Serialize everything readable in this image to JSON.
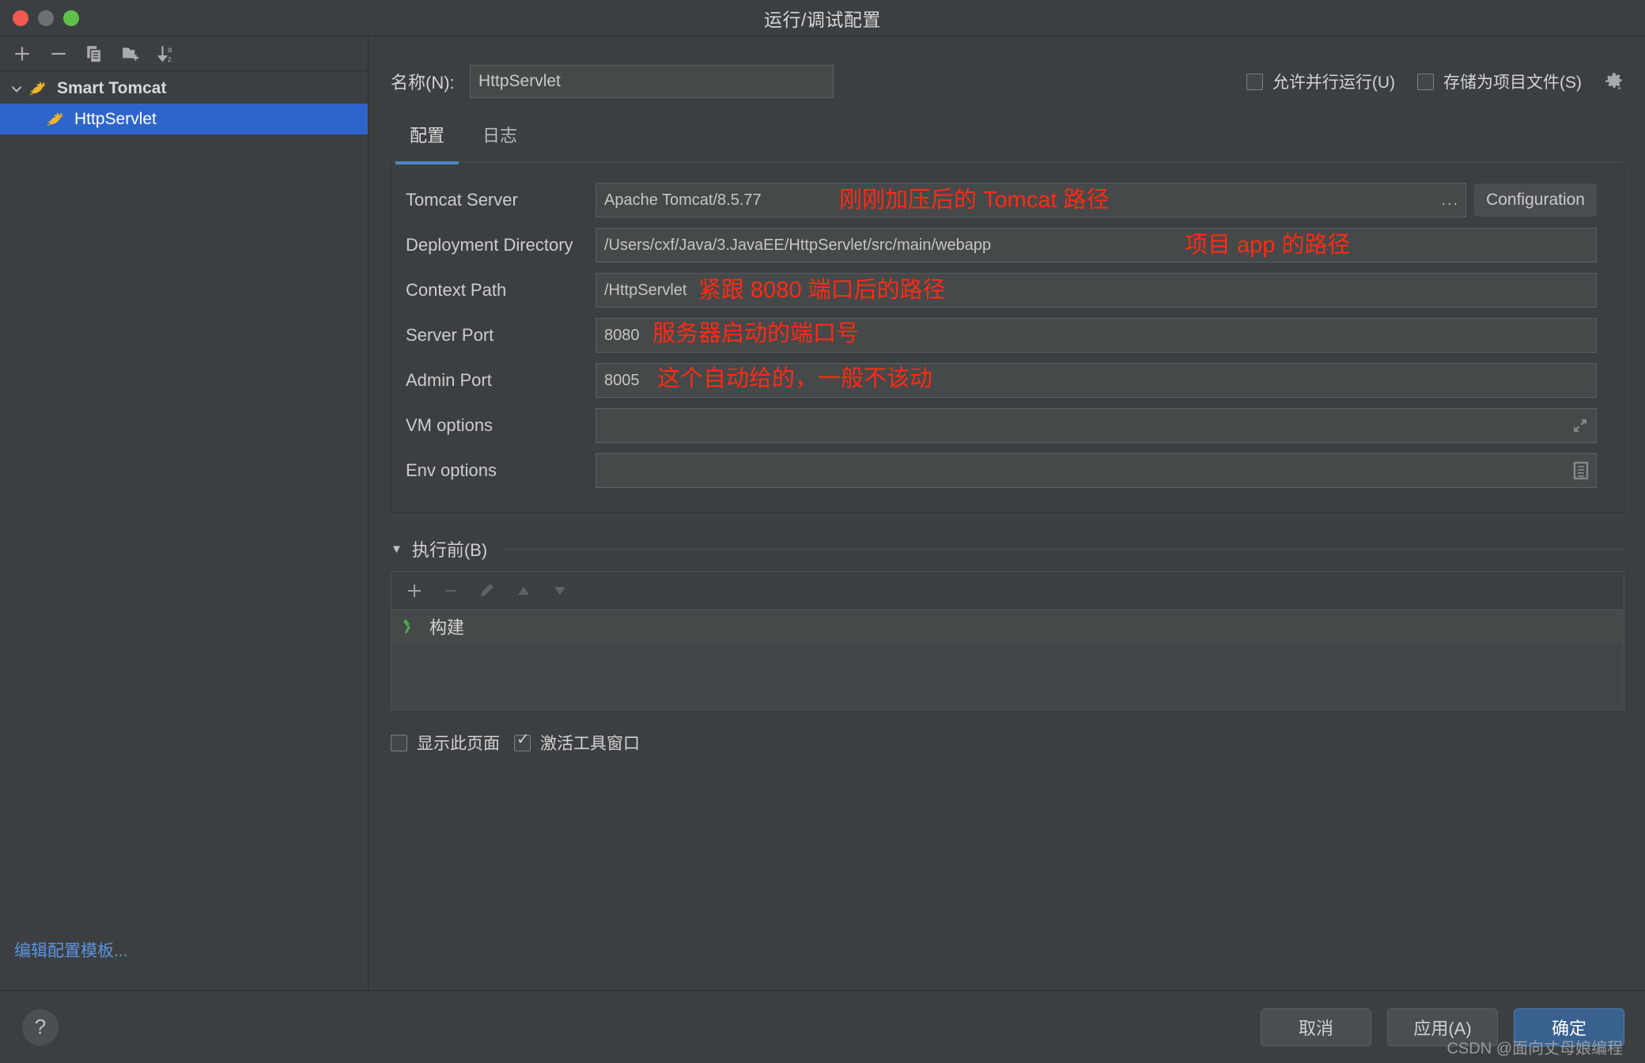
{
  "window": {
    "title": "运行/调试配置",
    "traffic_lights": [
      "close",
      "minimize",
      "zoom"
    ]
  },
  "sidebar": {
    "toolbar": [
      {
        "name": "add",
        "icon": "plus-icon"
      },
      {
        "name": "remove",
        "icon": "minus-icon"
      },
      {
        "name": "copy",
        "icon": "copy-icon"
      },
      {
        "name": "new-folder",
        "icon": "folder-add-icon"
      },
      {
        "name": "sort-alphabetically",
        "icon": "sort-az-icon"
      }
    ],
    "tree": [
      {
        "label": "Smart Tomcat",
        "type": "group",
        "expanded": true,
        "icon": "tomcat-icon"
      },
      {
        "label": "HttpServlet",
        "type": "child",
        "selected": true,
        "icon": "tomcat-icon"
      }
    ],
    "edit_templates_link": "编辑配置模板..."
  },
  "main": {
    "name_label": "名称(N):",
    "name_value": "HttpServlet",
    "allow_parallel_run": {
      "label": "允许并行运行(U)",
      "checked": false
    },
    "store_as_project_file": {
      "label": "存储为项目文件(S)",
      "checked": false
    },
    "gear_icon": "gear-dropdown-icon",
    "tabs": [
      {
        "label": "配置",
        "active": true
      },
      {
        "label": "日志",
        "active": false
      }
    ],
    "fields": [
      {
        "label": "Tomcat Server",
        "value": "Apache Tomcat/8.5.77",
        "browse": "...",
        "button": "Configuration",
        "annotation": "刚刚加压后的 Tomcat 路径"
      },
      {
        "label": "Deployment Directory",
        "value": "/Users/cxf/Java/3.JavaEE/HttpServlet/src/main/webapp",
        "browse": "",
        "annotation": "项目 app 的路径"
      },
      {
        "label": "Context Path",
        "value": "/HttpServlet",
        "annotation": "紧跟 8080 端口后的路径"
      },
      {
        "label": "Server Port",
        "value": "8080",
        "annotation": "服务器启动的端口号"
      },
      {
        "label": "Admin Port",
        "value": "8005",
        "annotation": "这个自动给的，一般不该动"
      },
      {
        "label": "VM options",
        "value": "",
        "icon": "expand-icon",
        "annotation": ""
      },
      {
        "label": "Env options",
        "value": "",
        "icon": "list-edit-icon",
        "annotation": ""
      }
    ],
    "before_launch": {
      "title": "执行前(B)",
      "toolbar": [
        {
          "name": "add-task",
          "icon": "plus-icon",
          "enabled": true
        },
        {
          "name": "remove-task",
          "icon": "minus-icon",
          "enabled": false
        },
        {
          "name": "edit-task",
          "icon": "pencil-icon",
          "enabled": false
        },
        {
          "name": "move-up",
          "icon": "arrow-up-icon",
          "enabled": false
        },
        {
          "name": "move-down",
          "icon": "arrow-down-icon",
          "enabled": false
        }
      ],
      "items": [
        {
          "label": "构建",
          "icon": "build-hammer-icon"
        }
      ]
    },
    "show_this_page": {
      "label": "显示此页面",
      "checked": false
    },
    "activate_tool_window": {
      "label": "激活工具窗口",
      "checked": true
    }
  },
  "footer": {
    "help_label": "?",
    "cancel": "取消",
    "apply": "应用(A)",
    "ok": "确定",
    "watermark": "CSDN @面向丈母娘编程"
  },
  "colors": {
    "window_bg": "#3c3f41",
    "selection_blue": "#2f65ca",
    "accent_tab": "#4a88c7",
    "link_blue": "#5c93e0",
    "annotation_red": "#fc2b14",
    "primary_button": "#39618f",
    "build_icon_green": "#49b049"
  }
}
